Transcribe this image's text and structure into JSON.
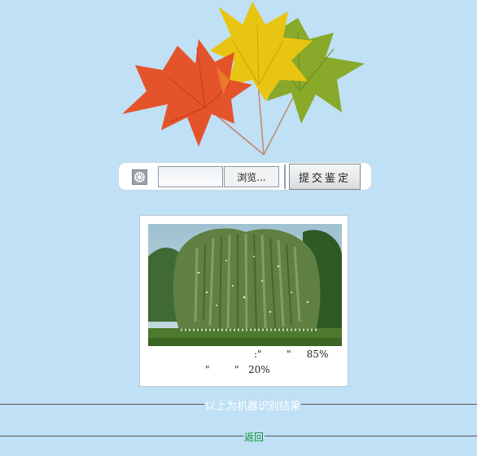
{
  "upload": {
    "picture_icon": "image-picker-icon",
    "browse_label": "浏览...",
    "submit_label": "提交鉴定"
  },
  "result": {
    "line1": ":\"        \"     85%",
    "line2": "\"        \"   20%"
  },
  "footer": {
    "caption": "以上为机器识别结果",
    "back_label": "返回"
  },
  "colors": {
    "background": "#bfe0f5",
    "link": "#08912f"
  }
}
